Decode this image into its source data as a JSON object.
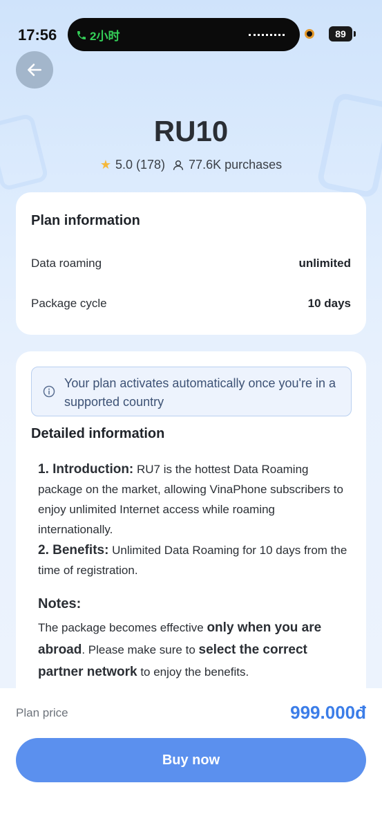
{
  "status_bar": {
    "time": "17:56",
    "call_label": "2小时",
    "battery": "89"
  },
  "header": {
    "title": "RU10",
    "rating": "5.0 (178)",
    "purchases": "77.6K purchases"
  },
  "plan_info": {
    "title": "Plan information",
    "rows": [
      {
        "label": "Data roaming",
        "value": "unlimited"
      },
      {
        "label": "Package cycle",
        "value": "10 days"
      }
    ]
  },
  "notice": {
    "text": "Your plan activates automatically once you're in a supported country"
  },
  "detail": {
    "title": "Detailed information",
    "intro_heading": "1. Introduction:",
    "intro_text": " RU7 is the hottest Data Roaming package on the market, allowing VinaPhone subscribers to enjoy unlimited Internet access while roaming internationally.",
    "benefits_heading": "2. Benefits:",
    "benefits_text": " Unlimited Data Roaming for 10 days from the time of registration.",
    "notes_title": "Notes:",
    "notes_part1": "The package becomes effective ",
    "notes_bold1": "only when you are abroad",
    "notes_part2": ". Please make sure to ",
    "notes_bold2": "select the correct partner network",
    "notes_part3": " to enjoy the benefits."
  },
  "footer": {
    "price_label": "Plan price",
    "price_value": "999.000đ",
    "buy_label": "Buy now"
  },
  "colors": {
    "accent": "#5b90ee",
    "price": "#3b7de8",
    "star": "#f5b83b"
  }
}
